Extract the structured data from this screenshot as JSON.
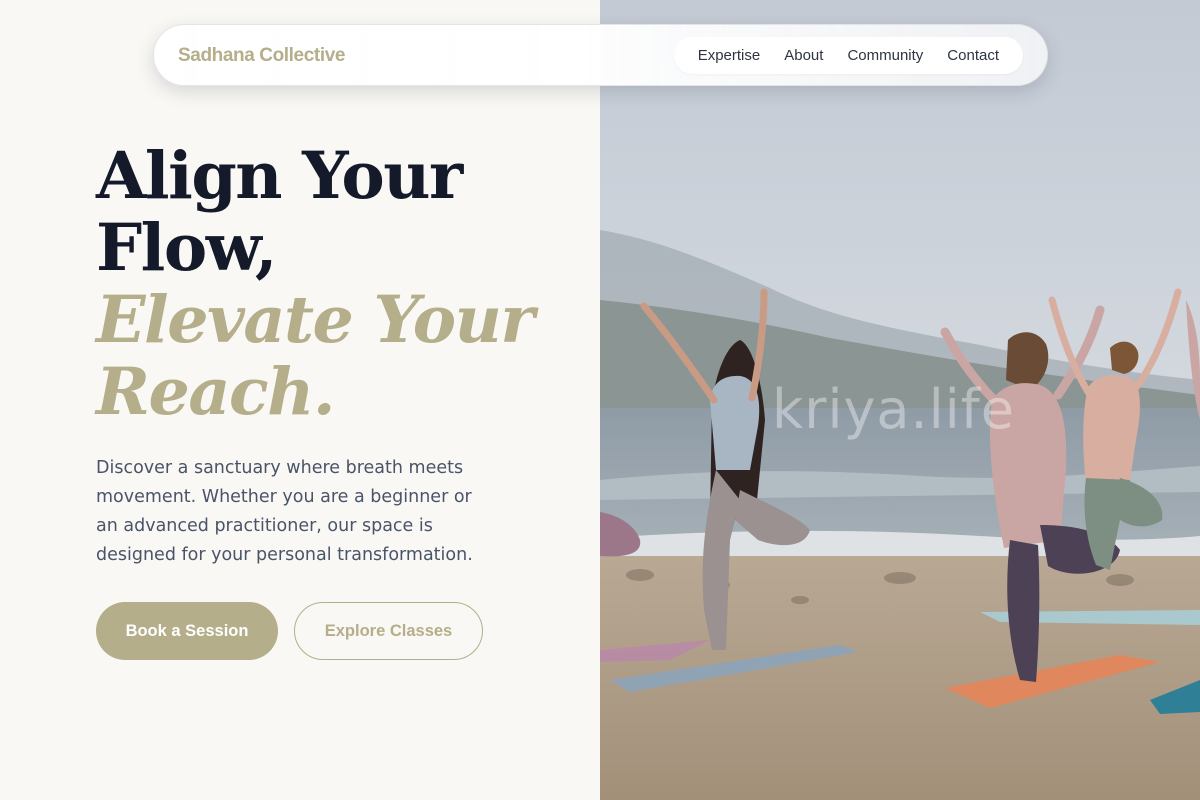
{
  "brand": {
    "name": "Sadhana Collective"
  },
  "nav": {
    "links": [
      "Expertise",
      "About",
      "Community",
      "Contact"
    ]
  },
  "hero": {
    "line1": "Align Your",
    "line2": "Flow,",
    "line3": "Elevate Your",
    "line4": "Reach.",
    "description": "Discover a sanctuary where breath meets movement. Whether you are a beginner or an advanced practitioner, our space is designed for your personal transformation.",
    "primary_cta": "Book a Session",
    "secondary_cta": "Explore Classes"
  },
  "photo": {
    "watermark": "kriya.life"
  },
  "colors": {
    "accent": "#b5ae8a",
    "heading": "#141a2a",
    "body_text": "#4a5468",
    "background": "#f9f8f4"
  }
}
